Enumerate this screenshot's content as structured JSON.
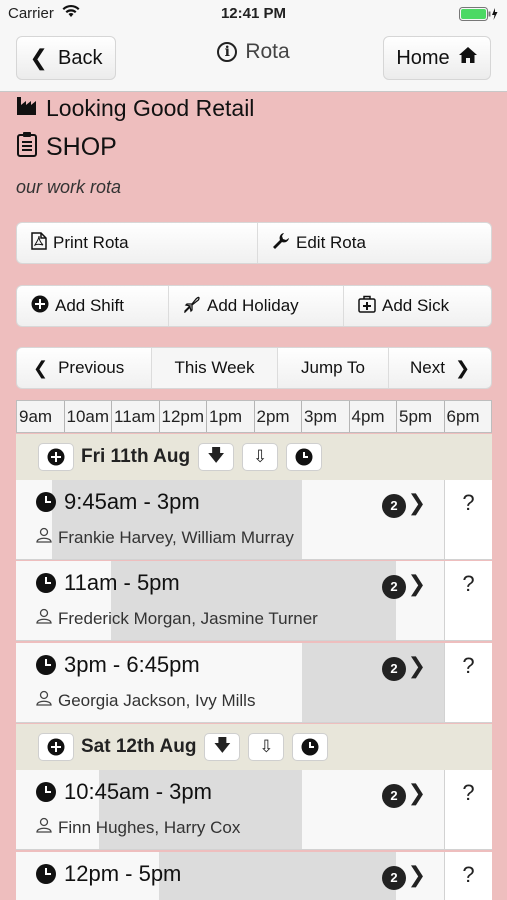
{
  "status": {
    "carrier": "Carrier",
    "time": "12:41 PM"
  },
  "nav": {
    "back_label": "Back",
    "title": "Rota",
    "home_label": "Home"
  },
  "header": {
    "company": "Looking Good Retail",
    "shop": "SHOP",
    "subtitle": "our work rota"
  },
  "toolbar1": {
    "print": "Print Rota",
    "edit": "Edit Rota"
  },
  "toolbar2": {
    "add_shift": "Add Shift",
    "add_holiday": "Add Holiday",
    "add_sick": "Add Sick"
  },
  "weeknav": {
    "previous": "Previous",
    "this_week": "This Week",
    "jump_to": "Jump To",
    "next": "Next"
  },
  "hours": [
    "9am",
    "10am",
    "11am",
    "12pm",
    "1pm",
    "2pm",
    "3pm",
    "4pm",
    "5pm",
    "6pm"
  ],
  "days": [
    {
      "label": "Fri 11th Aug",
      "shifts": [
        {
          "time": "9:45am - 3pm",
          "staff": "Frankie Harvey, William Murray",
          "count": "2"
        },
        {
          "time": "11am - 5pm",
          "staff": "Frederick Morgan, Jasmine Turner",
          "count": "2"
        },
        {
          "time": "3pm - 6:45pm",
          "staff": "Georgia Jackson, Ivy Mills",
          "count": "2"
        }
      ]
    },
    {
      "label": "Sat 12th Aug",
      "shifts": [
        {
          "time": "10:45am - 3pm",
          "staff": "Finn Hughes, Harry Cox",
          "count": "2"
        },
        {
          "time": "12pm - 5pm",
          "staff": "",
          "count": "2"
        }
      ]
    }
  ]
}
